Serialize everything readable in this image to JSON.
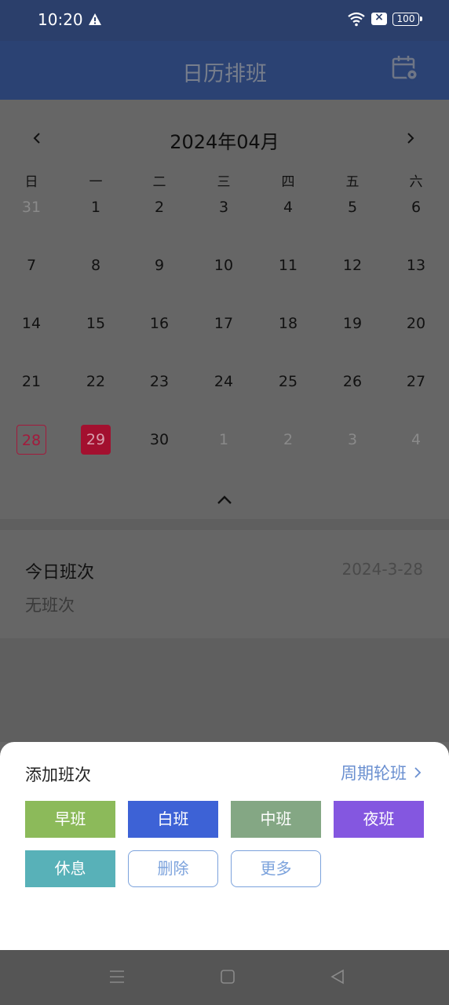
{
  "status": {
    "time": "10:20",
    "battery": "100",
    "sim_glyph": "×"
  },
  "header": {
    "title": "日历排班"
  },
  "calendar": {
    "month_title": "2024年04月",
    "weekdays": [
      "日",
      "一",
      "二",
      "三",
      "四",
      "五",
      "六"
    ],
    "weeks": [
      [
        "31",
        "1",
        "2",
        "3",
        "4",
        "5",
        "6"
      ],
      [
        "7",
        "8",
        "9",
        "10",
        "11",
        "12",
        "13"
      ],
      [
        "14",
        "15",
        "16",
        "17",
        "18",
        "19",
        "20"
      ],
      [
        "21",
        "22",
        "23",
        "24",
        "25",
        "26",
        "27"
      ],
      [
        "28",
        "29",
        "30",
        "1",
        "2",
        "3",
        "4"
      ]
    ],
    "today": "28",
    "selected": "29"
  },
  "today_card": {
    "label": "今日班次",
    "date": "2024-3-28",
    "empty_text": "无班次"
  },
  "sheet": {
    "title": "添加班次",
    "cycle_link": "周期轮班",
    "buttons": [
      {
        "label": "早班",
        "color": "#8cba5a"
      },
      {
        "label": "白班",
        "color": "#3d62d6"
      },
      {
        "label": "中班",
        "color": "#84a784"
      },
      {
        "label": "夜班",
        "color": "#8457e0"
      },
      {
        "label": "休息",
        "color": "#58b1b8"
      },
      {
        "label": "删除",
        "style": "outline"
      },
      {
        "label": "更多",
        "style": "outline"
      }
    ]
  },
  "colors": {
    "status_bar": "#2b3f6b",
    "header": "#2b4273",
    "accent_red": "#a3102f",
    "link_blue": "#6a8fd0"
  },
  "icons": [
    "warning-icon",
    "wifi-icon",
    "sim-icon",
    "battery-icon",
    "calendar-settings-icon",
    "chevron-left-icon",
    "chevron-right-icon",
    "chevron-up-icon",
    "menu-icon",
    "home-icon",
    "back-icon"
  ]
}
